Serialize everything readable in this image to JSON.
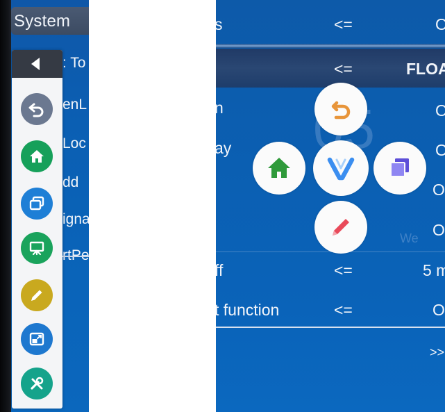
{
  "left_panel": {
    "header_title": "System",
    "labels": [
      ": To",
      "enL",
      "Loc",
      "dd",
      "igna",
      "rtPe"
    ],
    "floating_bar": {
      "collapse_icon": "triangle-left-icon",
      "buttons": [
        {
          "icon": "undo-icon",
          "color": "#6b7890"
        },
        {
          "icon": "home-icon",
          "color": "#16a05a"
        },
        {
          "icon": "windows-icon",
          "color": "#1e7fd6"
        },
        {
          "icon": "whiteboard-icon",
          "color": "#1aa35c"
        },
        {
          "icon": "pen-icon",
          "color": "#c9a91f"
        },
        {
          "icon": "window-resize-icon",
          "color": "#1e78cf"
        },
        {
          "icon": "tools-icon",
          "color": "#15a38b"
        }
      ]
    }
  },
  "right_panel": {
    "rows": [
      {
        "label": "s",
        "arrow": "<=",
        "value": "O"
      },
      {
        "label": "",
        "arrow": "<=",
        "value": "FLOA"
      },
      {
        "label": "n",
        "arrow": "",
        "value": "O"
      },
      {
        "label": "ay",
        "arrow": "",
        "value": "O"
      },
      {
        "label": "",
        "arrow": "",
        "value": "Ol"
      },
      {
        "label": "",
        "arrow": "",
        "value": "Ol"
      },
      {
        "label": "ff",
        "arrow": "<=",
        "value": "5 m"
      },
      {
        "label": "t function",
        "arrow": "<=",
        "value": "O"
      }
    ],
    "more_arrow": ">>",
    "ghost_watermark": "We",
    "ghost_digits": "05",
    "cross_menu": {
      "top": {
        "icon": "undo-icon",
        "color": "#e8953a"
      },
      "left": {
        "icon": "home-icon",
        "color": "#2f9a3a"
      },
      "center": {
        "icon": "v-logo-icon",
        "color": "#2f7ee6"
      },
      "right": {
        "icon": "windows-icon",
        "color": "#7766e8"
      },
      "bottom": {
        "icon": "pen-icon",
        "color": "#e94a5a"
      }
    }
  }
}
